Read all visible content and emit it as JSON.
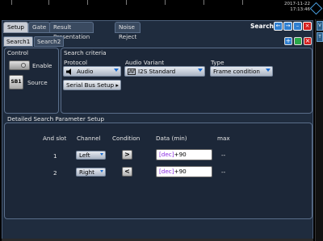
{
  "window": {
    "date": "2017-11-22",
    "time": "17:13:46",
    "title": "Search"
  },
  "tabs": [
    "Setup",
    "Gate",
    "Result Presentation",
    "Noise Reject"
  ],
  "subtabs": [
    "Search1",
    "Search2"
  ],
  "control": {
    "title": "Control",
    "enable_label": "Enable",
    "source_label": "Source",
    "source_value": "SB1"
  },
  "criteria": {
    "title": "Search criteria",
    "protocol_label": "Protocol",
    "protocol_value": "Audio",
    "variant_label": "Audio Variant",
    "variant_value": "I2S Standard",
    "type_label": "Type",
    "type_value": "Frame condition",
    "serial_setup_label": "Serial Bus Setup"
  },
  "detailed": {
    "title": "Detailed Search Parameter Setup",
    "headers": {
      "slot": "And slot",
      "channel": "Channel",
      "condition": "Condition",
      "data": "Data (min)",
      "max": "max"
    },
    "rows": [
      {
        "slot": "1",
        "channel": "Left",
        "condition": ">",
        "data_prefix": "[dec]",
        "data_value": "+90",
        "max": "--"
      },
      {
        "slot": "2",
        "channel": "Right",
        "condition": "<",
        "data_prefix": "[dec]",
        "data_value": "+90",
        "max": "--"
      }
    ]
  },
  "right_strip": [
    "V",
    "T"
  ],
  "colors": {
    "panel_bg": "#1f2c3e",
    "accent_blue": "#2f7fd0",
    "close_red": "#d42020",
    "add_green": "#2aa84a"
  }
}
